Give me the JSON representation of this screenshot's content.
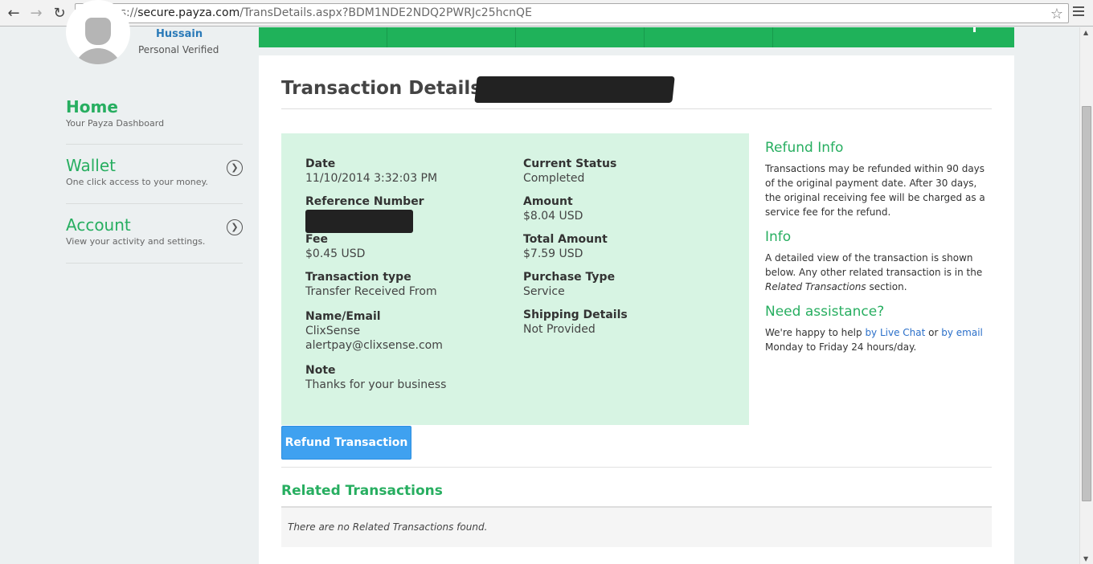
{
  "browser": {
    "url_scheme": "https://",
    "url_host": "secure.payza.com",
    "url_path": "/TransDetails.aspx?BDM1NDE2NDQ2PWRJc25hcnQE"
  },
  "sidebar": {
    "user_name": "Hussain",
    "user_status": "Personal Verified",
    "items": [
      {
        "title": "Home",
        "subtitle": "Your Payza Dashboard"
      },
      {
        "title": "Wallet",
        "subtitle": "One click access to your money."
      },
      {
        "title": "Account",
        "subtitle": "View your activity and settings."
      }
    ]
  },
  "main": {
    "title": "Transaction Details for",
    "details": {
      "date": {
        "label": "Date",
        "value": "11/10/2014 3:32:03 PM"
      },
      "reference": {
        "label": "Reference Number"
      },
      "fee": {
        "label": "Fee",
        "value": "$0.45 USD"
      },
      "transaction_type": {
        "label": "Transaction type",
        "value": "Transfer Received From"
      },
      "name_email": {
        "label": "Name/Email",
        "name": "ClixSense",
        "email": "alertpay@clixsense.com"
      },
      "note": {
        "label": "Note",
        "value": "Thanks for your business"
      },
      "status": {
        "label": "Current Status",
        "value": "Completed"
      },
      "amount": {
        "label": "Amount",
        "value": "$8.04 USD"
      },
      "total": {
        "label": "Total Amount",
        "value": "$7.59 USD"
      },
      "purchase_type": {
        "label": "Purchase Type",
        "value": "Service"
      },
      "shipping": {
        "label": "Shipping Details",
        "value": "Not Provided"
      }
    },
    "refund_button": "Refund Transaction",
    "related": {
      "title": "Related Transactions",
      "empty_text": "There are no Related Transactions found."
    }
  },
  "side_info": {
    "refund": {
      "heading": "Refund Info",
      "text": "Transactions may be refunded within 90 days of the original payment date. After 30 days, the original receiving fee will be charged as a service fee for the refund."
    },
    "info": {
      "heading": "Info",
      "text_before": "A detailed view of the transaction is shown below. Any other related transaction is in the ",
      "text_em": "Related Transactions",
      "text_after": " section."
    },
    "assist": {
      "heading": "Need assistance?",
      "text_before": "We're happy to help ",
      "link_chat": "by Live Chat",
      "text_mid": " or ",
      "link_email": "by email",
      "text_after": " Monday to Friday 24 hours/day."
    }
  },
  "colors": {
    "brand_green": "#27ae60",
    "details_bg": "#d7f4e3",
    "button_blue": "#3fa1f0",
    "link_blue": "#2a6fc9"
  }
}
